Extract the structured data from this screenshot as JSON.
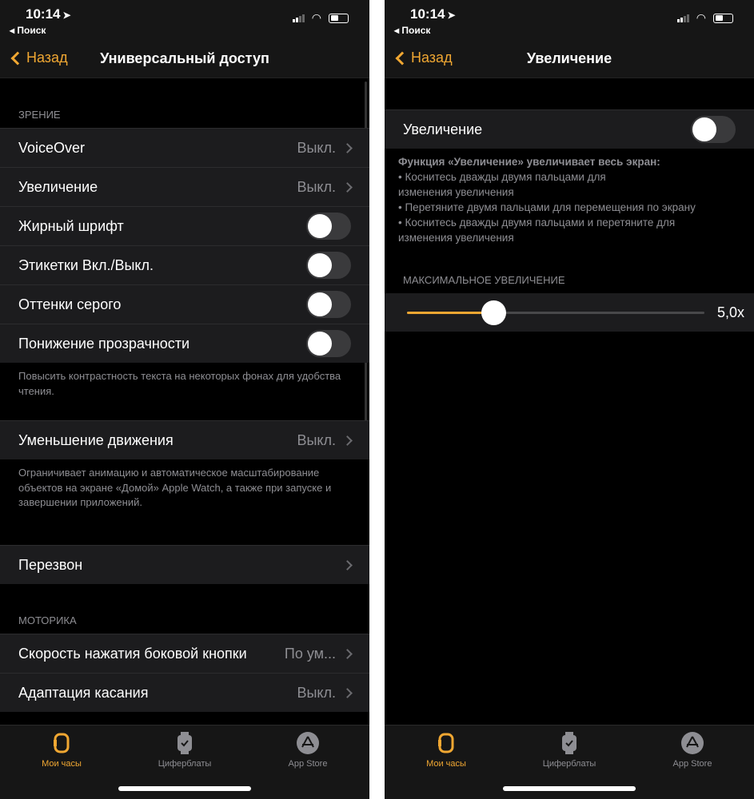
{
  "status": {
    "time": "10:14",
    "back_app": "Поиск"
  },
  "colors": {
    "accent": "#f0a732",
    "bg": "#000000",
    "cell": "#1c1c1e"
  },
  "left": {
    "back": "Назад",
    "title": "Универсальный доступ",
    "vision_header": "Зрение",
    "rows": [
      {
        "label": "VoiceOver",
        "value": "Выкл."
      },
      {
        "label": "Увеличение",
        "value": "Выкл."
      },
      {
        "label": "Жирный шрифт",
        "toggle": false
      },
      {
        "label": "Этикетки Вкл./Выкл.",
        "toggle": false
      },
      {
        "label": "Оттенки серого",
        "toggle": false
      },
      {
        "label": "Понижение прозрачности",
        "toggle": false
      }
    ],
    "transparency_footer": "Повысить контрастность текста на некоторых фонах для удобства чтения.",
    "reduce_motion": {
      "label": "Уменьшение движения",
      "value": "Выкл."
    },
    "motion_footer": "Ограничивает анимацию и автоматическое масштабирование объектов на экране «Домой» Apple Watch, а также при запуске и завершении приложений.",
    "chimes": {
      "label": "Перезвон"
    },
    "motor_header": "Моторика",
    "side_button": {
      "label": "Скорость нажатия боковой кнопки",
      "value": "По ум..."
    },
    "touch_accommodations": {
      "label": "Адаптация касания",
      "value": "Выкл."
    }
  },
  "right": {
    "back": "Назад",
    "title": "Увеличение",
    "zoom_row": {
      "label": "Увеличение",
      "toggle": false
    },
    "desc_title": "Функция «Увеличение» увеличивает весь экран:",
    "desc_lines": [
      "•  Коснитесь дважды двумя пальцами для",
      "изменения увеличения",
      "•  Перетяните двумя пальцами для перемещения по экрану",
      "•  Коснитесь дважды двумя пальцами и перетяните для",
      "изменения увеличения"
    ],
    "max_header": "Максимальное увеличение",
    "slider_fraction": 0.29,
    "slider_value": "5,0x"
  },
  "tabs": [
    {
      "label": "Мои часы",
      "icon": "watch-icon",
      "active": true
    },
    {
      "label": "Циферблаты",
      "icon": "watch-face-icon"
    },
    {
      "label": "App Store",
      "icon": "app-store-icon"
    }
  ]
}
